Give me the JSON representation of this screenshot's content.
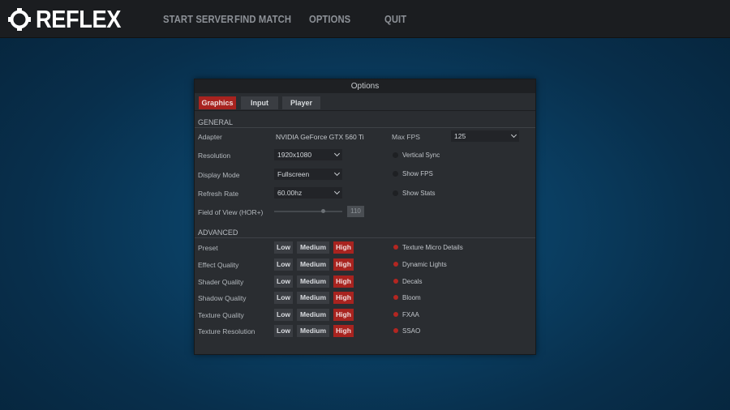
{
  "brand": {
    "name": "REFLEX",
    "logo_icon": "reflex-ring-logo"
  },
  "nav": {
    "items": [
      {
        "label": "START SERVER"
      },
      {
        "label": "FIND MATCH"
      },
      {
        "label": "OPTIONS"
      },
      {
        "label": "QUIT"
      }
    ]
  },
  "panel": {
    "title": "Options",
    "tabs": [
      {
        "label": "Graphics",
        "active": true
      },
      {
        "label": "Input",
        "active": false
      },
      {
        "label": "Player",
        "active": false
      }
    ],
    "general": {
      "heading": "GENERAL",
      "adapter": {
        "label": "Adapter",
        "value": "NVIDIA GeForce GTX 560 Ti"
      },
      "resolution": {
        "label": "Resolution",
        "value": "1920x1080"
      },
      "display_mode": {
        "label": "Display Mode",
        "value": "Fullscreen"
      },
      "refresh_rate": {
        "label": "Refresh Rate",
        "value": "60.00hz"
      },
      "fov": {
        "label": "Field of View (HOR+)",
        "value": "110",
        "slider_fraction": 0.72
      },
      "max_fps": {
        "label": "Max FPS",
        "value": "125"
      },
      "toggles": [
        {
          "label": "Vertical Sync",
          "on": false
        },
        {
          "label": "Show FPS",
          "on": false
        },
        {
          "label": "Show Stats",
          "on": false
        }
      ]
    },
    "advanced": {
      "heading": "ADVANCED",
      "levels": [
        "Low",
        "Medium",
        "High"
      ],
      "rows": [
        {
          "label": "Preset",
          "selected": "High"
        },
        {
          "label": "Effect Quality",
          "selected": "High"
        },
        {
          "label": "Shader Quality",
          "selected": "High"
        },
        {
          "label": "Shadow Quality",
          "selected": "High"
        },
        {
          "label": "Texture Quality",
          "selected": "High"
        },
        {
          "label": "Texture Resolution",
          "selected": "High"
        }
      ],
      "toggles": [
        {
          "label": "Texture Micro Details",
          "on": true
        },
        {
          "label": "Dynamic Lights",
          "on": true
        },
        {
          "label": "Decals",
          "on": true
        },
        {
          "label": "Bloom",
          "on": true
        },
        {
          "label": "FXAA",
          "on": true
        },
        {
          "label": "SSAO",
          "on": true
        }
      ]
    }
  },
  "colors": {
    "accent_red": "#a8231f",
    "panel_bg": "#2a2d31",
    "topbar_bg": "#1b1d20",
    "background_blue": "#0a3f63"
  }
}
